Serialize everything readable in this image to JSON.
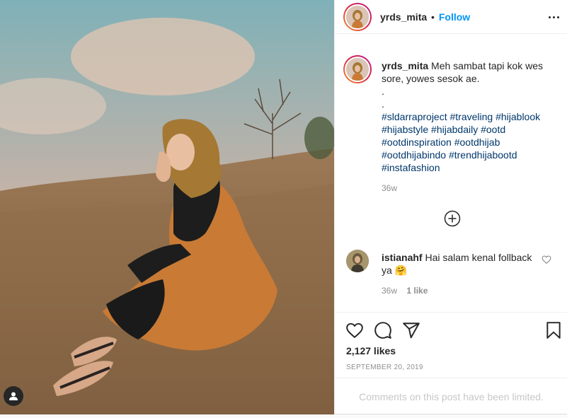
{
  "header": {
    "username": "yrds_mita",
    "separator": "•",
    "follow_label": "Follow",
    "more_icon": "more-horizontal-icon"
  },
  "caption": {
    "username": "yrds_mita",
    "text": "Meh sambat tapi kok wes sore, yowes sesok ae.",
    "dot1": ".",
    "dot2": ".",
    "hashtags": "#sldarraproject #traveling #hijablook #hijabstyle #hijabdaily #ootd #ootdinspiration #ootdhijab #ootdhijabindo #trendhijabootd #instafashion",
    "age": "36w"
  },
  "load_more_icon": "plus-circle-icon",
  "comment": {
    "username": "istianahf",
    "text": "Hai salam kenal follback ya",
    "emoji": "🤗",
    "age": "36w",
    "likes": "1 like"
  },
  "actions": {
    "like_icon": "heart-icon",
    "comment_icon": "comment-icon",
    "share_icon": "share-icon",
    "save_icon": "bookmark-icon"
  },
  "likes_count": "2,127 likes",
  "post_date": "SEPTEMBER 20, 2019",
  "comments_limited": "Comments on this post have been limited.",
  "colors": {
    "follow": "#0095f6",
    "hashtag": "#00376b",
    "muted": "#8e8e8e"
  }
}
